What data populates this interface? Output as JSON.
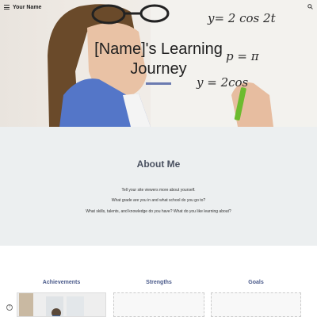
{
  "header": {
    "site_name": "Your Name",
    "menu_icon": "menu-icon",
    "search_icon": "search-icon"
  },
  "hero": {
    "title_line1": "[Name]'s Learning",
    "title_line2": "Journey",
    "board_formulas": [
      "y= 2 cos 2t",
      "p = π",
      "y = 2cos"
    ],
    "accent_color": "#6b7bb0"
  },
  "about": {
    "heading": "About Me",
    "lines": [
      "Tell your site viewers more about yourself.",
      "What grade are you in and what school do you go to?",
      "What skills, talents, and knowledge do you have? What do you like learning about?"
    ]
  },
  "columns": [
    {
      "heading": "Achievements"
    },
    {
      "heading": "Strengths"
    },
    {
      "heading": "Goals"
    }
  ],
  "help_icon": "help-icon"
}
